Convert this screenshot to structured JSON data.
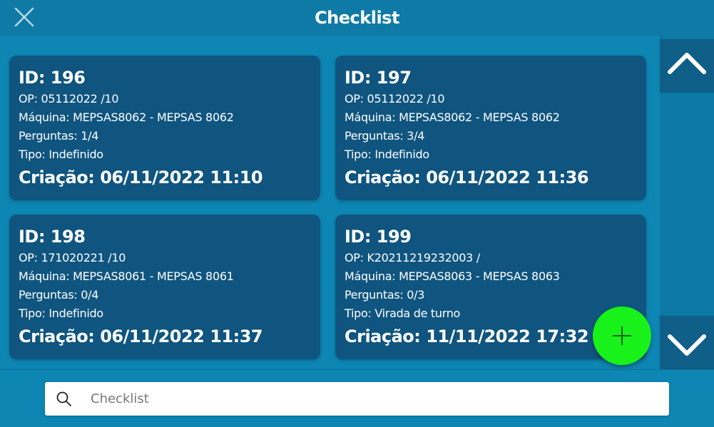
{
  "header": {
    "title": "Checklist",
    "close_icon": "close-icon"
  },
  "cards": [
    {
      "id": "ID: 196",
      "op": "OP: 05112022 /10",
      "machine": "Máquina: MEPSAS8062 - MEPSAS 8062",
      "questions": "Perguntas: 1/4",
      "type": "Tipo: Indefinido",
      "created": "Criação: 06/11/2022 11:10"
    },
    {
      "id": "ID: 197",
      "op": "OP: 05112022 /10",
      "machine": "Máquina: MEPSAS8062 - MEPSAS 8062",
      "questions": "Perguntas: 3/4",
      "type": "Tipo: Indefinido",
      "created": "Criação: 06/11/2022 11:36"
    },
    {
      "id": "ID: 198",
      "op": "OP: 171020221 /10",
      "machine": "Máquina: MEPSAS8061 - MEPSAS 8061",
      "questions": "Perguntas: 0/4",
      "type": "Tipo: Indefinido",
      "created": "Criação: 06/11/2022 11:37"
    },
    {
      "id": "ID: 199",
      "op": "OP: K20211219232003 /",
      "machine": "Máquina: MEPSAS8063 - MEPSAS 8063",
      "questions": "Perguntas: 0/3",
      "type": "Tipo: Virada de turno",
      "created": "Criação: 11/11/2022 17:32"
    }
  ],
  "scroll": {
    "up_icon": "chevron-up-icon",
    "down_icon": "chevron-down-icon"
  },
  "fab": {
    "icon": "plus-icon",
    "color": "#19f21a"
  },
  "search": {
    "placeholder": "Checklist",
    "value": "",
    "icon": "search-icon"
  },
  "colors": {
    "background": "#0d86b3",
    "header": "#0f7aa5",
    "card": "#0f557f",
    "scroll_button": "#0f5f89"
  }
}
